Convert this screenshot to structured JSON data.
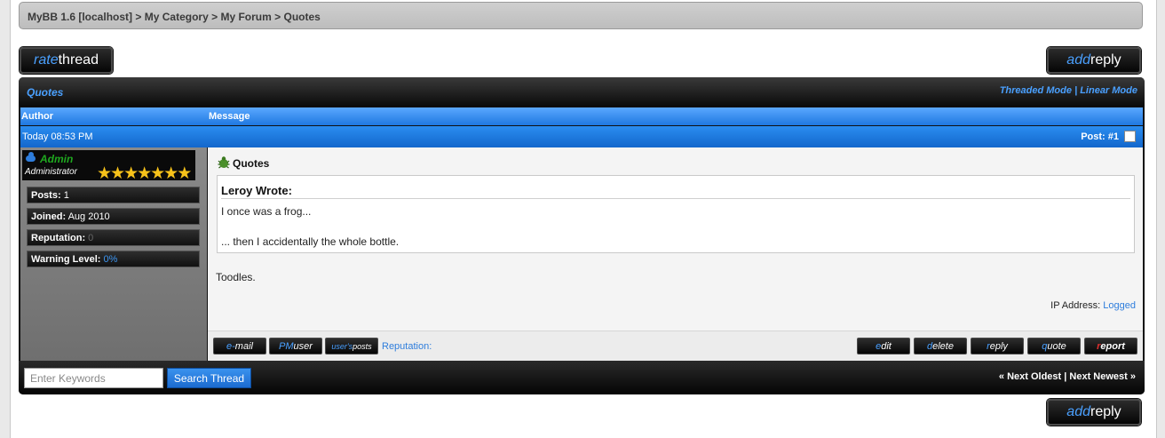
{
  "breadcrumb": {
    "items": [
      "MyBB 1.6 [localhost]",
      "My Category",
      "My Forum",
      "Quotes"
    ],
    "separator": ">"
  },
  "buttons": {
    "rate_prefix": "rate",
    "rate_suffix": "thread",
    "add_prefix": "add",
    "add_suffix": "reply"
  },
  "thread": {
    "title": "Quotes",
    "threaded_mode": "Threaded Mode",
    "mode_sep": "|",
    "linear_mode": "Linear Mode"
  },
  "columns": {
    "author": "Author",
    "message": "Message"
  },
  "post": {
    "date": "Today 08:53 PM",
    "number": "Post: #1",
    "author": {
      "name": "Admin",
      "role": "Administrator",
      "stars": "★★★★★★★",
      "stats": [
        {
          "label": "Posts:",
          "value": "1"
        },
        {
          "label": "Joined:",
          "value": "Aug 2010"
        },
        {
          "label": "Reputation:",
          "value": "0"
        },
        {
          "label": "Warning Level:",
          "value": "0%"
        }
      ]
    },
    "subject": "Quotes",
    "quote": {
      "header": "Leroy Wrote:",
      "line1": "I once was a frog...",
      "line2": "... then I accidentally the whole bottle."
    },
    "body": "Toodles.",
    "ip_label": "IP Address:",
    "ip_value": "Logged",
    "user_buttons": {
      "email_a": "e-",
      "email_b": "mail",
      "pm_a": "PM",
      "pm_b": "user",
      "posts_a": "user's",
      "posts_b": "posts"
    },
    "reputation_label": "Reputation:",
    "mod_buttons": {
      "edit_a": "e",
      "edit_b": "dit",
      "delete_a": "d",
      "delete_b": "elete",
      "reply_a": "r",
      "reply_b": "eply",
      "quote_a": "q",
      "quote_b": "uote",
      "report_a": "r",
      "report_b": "eport"
    }
  },
  "footer": {
    "search_placeholder": "Enter Keywords",
    "search_button": "Search Thread",
    "next_oldest": "« Next Oldest",
    "link_sep": "|",
    "next_newest": "Next Newest »"
  },
  "colors": {
    "accent_blue": "#4aa0ff",
    "header_blue": "#1f78e0",
    "admin_green": "#1fa81f",
    "star_gold": "#f6c21a",
    "report_red": "#e03030"
  }
}
